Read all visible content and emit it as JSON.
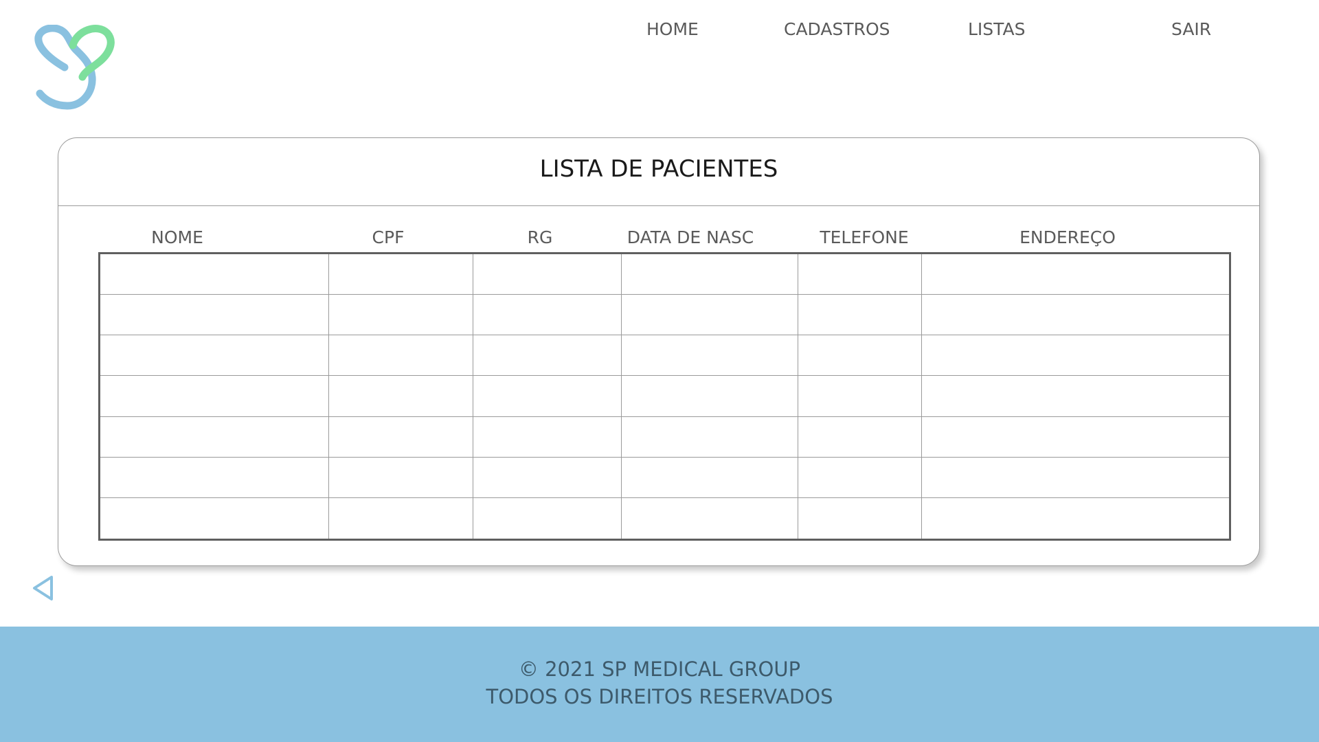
{
  "brand": {
    "logo_icon": "heart-s-logo",
    "colors": {
      "logo_blue": "#8ac1e0",
      "logo_green": "#7ddf9c",
      "footer_background": "#8ac1e0",
      "nav_text": "#5a5a5a",
      "footer_text": "#3d5a6b"
    }
  },
  "nav": {
    "home": "HOME",
    "cadastros": "CADASTROS",
    "listas": "LISTAS",
    "sair": "SAIR"
  },
  "main": {
    "title": "LISTA DE PACIENTES",
    "columns": [
      "NOME",
      "CPF",
      "RG",
      "DATA DE NASC",
      "TELEFONE",
      "ENDEREÇO"
    ],
    "rows": [
      [
        "",
        "",
        "",
        "",
        "",
        ""
      ],
      [
        "",
        "",
        "",
        "",
        "",
        ""
      ],
      [
        "",
        "",
        "",
        "",
        "",
        ""
      ],
      [
        "",
        "",
        "",
        "",
        "",
        ""
      ],
      [
        "",
        "",
        "",
        "",
        "",
        ""
      ],
      [
        "",
        "",
        "",
        "",
        "",
        ""
      ],
      [
        "",
        "",
        "",
        "",
        "",
        ""
      ]
    ],
    "back_icon": "triangle-left-icon"
  },
  "footer": {
    "copyright": "© 2021 SP MEDICAL GROUP",
    "rights": "TODOS OS DIREITOS RESERVADOS"
  }
}
